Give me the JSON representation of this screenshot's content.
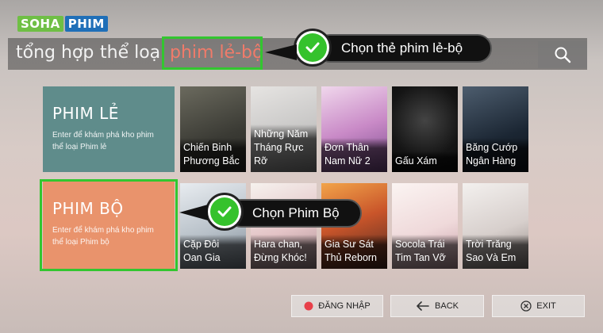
{
  "logo": {
    "part1": "SOHA",
    "part2": "PHIM"
  },
  "nav": {
    "items": [
      {
        "label": "tổng hợp"
      },
      {
        "label": "thể loại"
      },
      {
        "label": "phim lẻ-bộ"
      }
    ],
    "active_index": 2
  },
  "callouts": {
    "nav_tip": "Chọn thẻ phim lẻ-bộ",
    "tile_tip": "Chọn Phim Bộ"
  },
  "categories": [
    {
      "title": "PHIM LẺ",
      "desc": "Enter để khám phá kho phim thể loại Phim lẻ"
    },
    {
      "title": "PHIM BỘ",
      "desc": "Enter để khám phá kho phim thể loại Phim bộ"
    }
  ],
  "posters_row1": [
    {
      "line1": "Chiến Binh",
      "line2": "Phương Bắc"
    },
    {
      "line1": "Những Năm",
      "line2": "Tháng Rực",
      "line3": "Rỡ"
    },
    {
      "line1": "Đơn Thân",
      "line2": "Nam Nữ 2"
    },
    {
      "line1": "Gấu Xám",
      "line2": ""
    },
    {
      "line1": "Băng Cướp",
      "line2": "Ngân Hàng"
    }
  ],
  "posters_row2": [
    {
      "line1": "Cặp Đôi",
      "line2": "Oan Gia"
    },
    {
      "line1": "Hara chan,",
      "line2": "Đừng Khóc!"
    },
    {
      "line1": "Gia Sư Sát",
      "line2": "Thủ Reborn"
    },
    {
      "line1": "Socola Trái",
      "line2": "Tim Tan Vỡ"
    },
    {
      "line1": "Trời Trăng",
      "line2": "Sao Và Em"
    }
  ],
  "buttons": {
    "login": "ĐĂNG NHẬP",
    "back": "BACK",
    "exit": "EXIT"
  },
  "colors": {
    "highlight_green": "#33c630",
    "active_nav": "#f07b6a",
    "tile_le": "#5f8c8b",
    "tile_bo": "#e9936c",
    "login_dot": "#e8404a"
  }
}
